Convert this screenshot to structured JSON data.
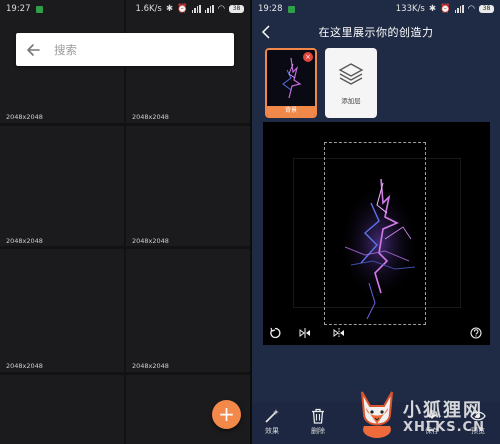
{
  "left": {
    "status": {
      "time": "19:27",
      "speed": "1.6K/s",
      "battery": "38"
    },
    "search": {
      "placeholder": "搜索"
    },
    "cells": [
      "2048x2048",
      "2048x2048",
      "2048x2048",
      "2048x2048",
      "2048x2048",
      "2048x2048"
    ],
    "fab_label": "+"
  },
  "right": {
    "status": {
      "time": "19:28",
      "speed": "133K/s",
      "battery": "38"
    },
    "title": "在这里展示你的创造力",
    "layers": {
      "background_label": "背景",
      "add_label": "添加层",
      "delete_symbol": "×"
    },
    "toolbar": {
      "effects_label": "效果",
      "delete_label": "删除",
      "save_label": "保存",
      "preview_label": "预览"
    }
  },
  "watermark": {
    "line1": "小狐狸网",
    "line2": "XHLKS.CN"
  },
  "colors": {
    "accent": "#f2884a",
    "left_bg": "#1b1b1d",
    "right_bg": "#1f2a45",
    "delete_red": "#e2453b"
  }
}
